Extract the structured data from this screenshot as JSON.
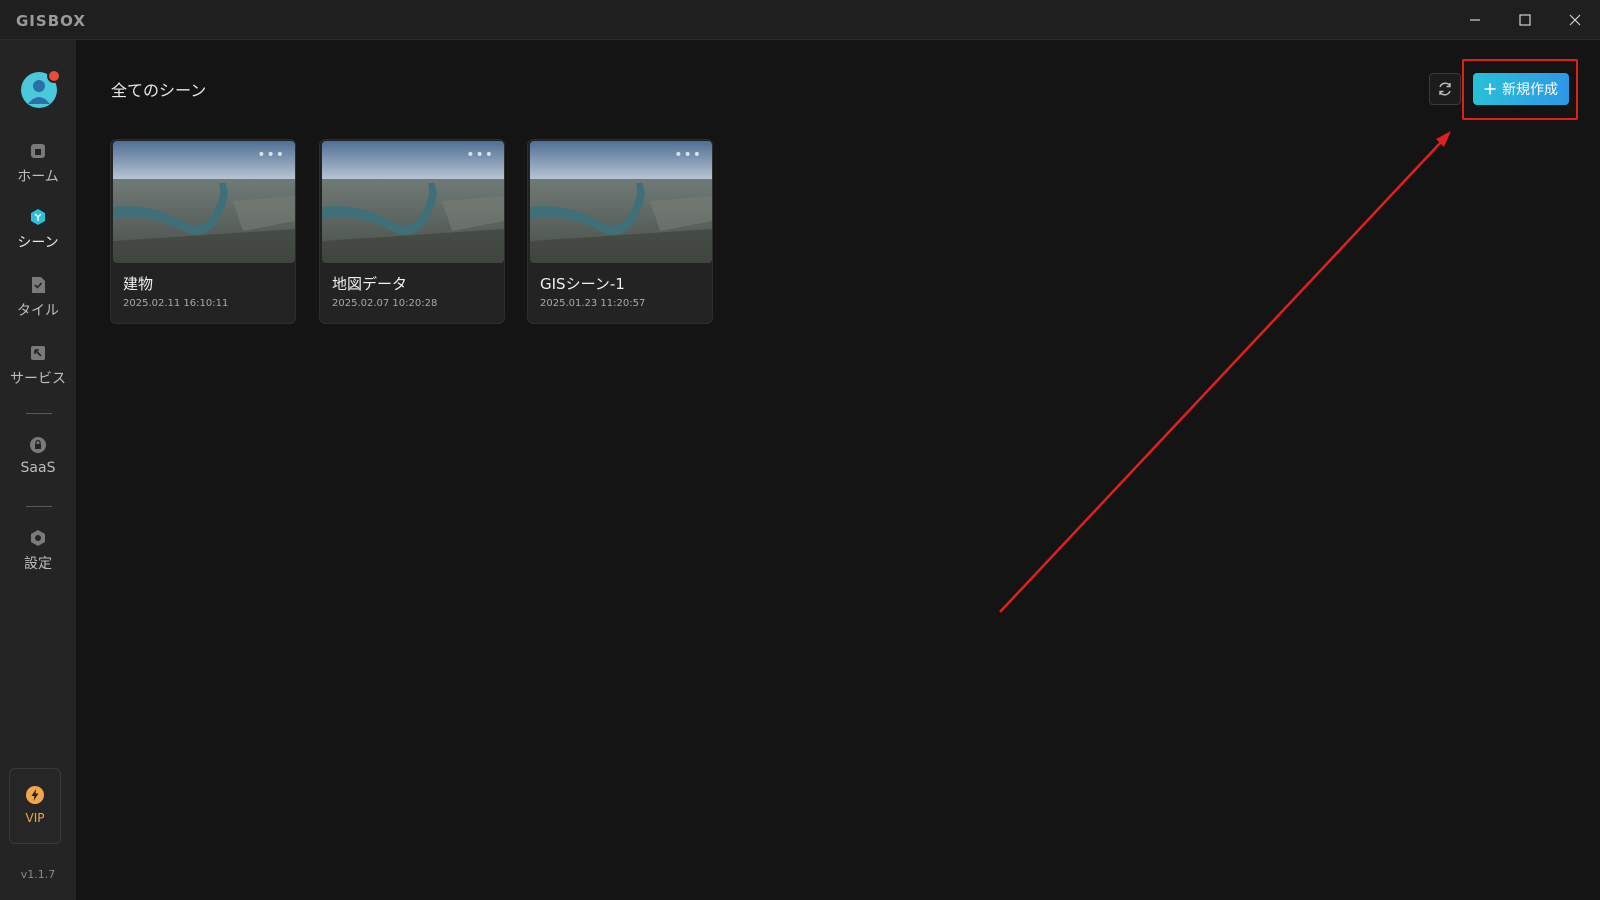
{
  "app": {
    "logo": "GISBOX",
    "version": "v1.1.7"
  },
  "window_controls": {
    "minimize": "—",
    "maximize": "☐",
    "close": "✕"
  },
  "sidebar": {
    "items": [
      {
        "label": "ホーム",
        "icon": "home-icon"
      },
      {
        "label": "シーン",
        "icon": "scene-cube-icon"
      },
      {
        "label": "タイル",
        "icon": "tile-check-icon"
      },
      {
        "label": "サービス",
        "icon": "service-icon"
      },
      {
        "label": "SaaS",
        "icon": "lock-icon"
      },
      {
        "label": "設定",
        "icon": "settings-icon"
      }
    ],
    "vip_label": "VIP"
  },
  "main": {
    "title": "全てのシーン",
    "new_button_label": "新規作成",
    "cards": [
      {
        "name": "建物",
        "date": "2025.02.11 16:10:11"
      },
      {
        "name": "地図データ",
        "date": "2025.02.07 10:20:28"
      },
      {
        "name": "GISシーン-1",
        "date": "2025.01.23 11:20:57"
      }
    ]
  },
  "colors": {
    "accent_start": "#28c1d6",
    "accent_end": "#2e97e8",
    "annotation": "#e0201c",
    "vip": "#f0a64a"
  }
}
